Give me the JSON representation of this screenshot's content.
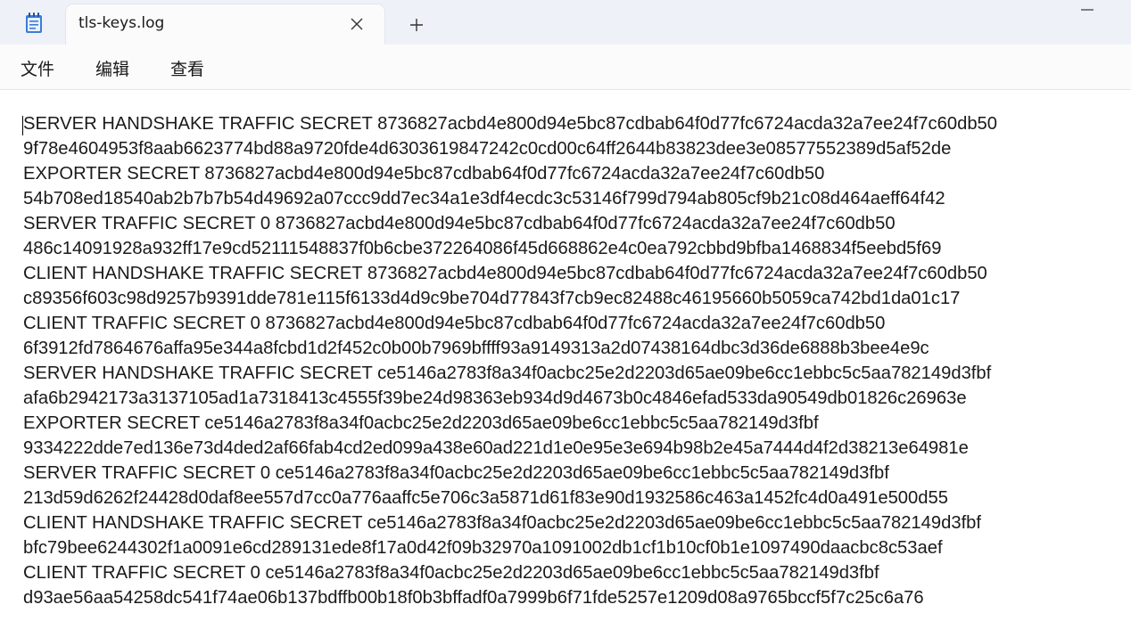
{
  "window": {
    "tab_title": "tls-keys.log",
    "icons": {
      "app": "notepad-icon",
      "close": "close-icon",
      "new_tab": "plus-icon",
      "minimize": "minimize-icon"
    }
  },
  "menu": {
    "items": [
      "文件",
      "编辑",
      "查看"
    ]
  },
  "editor": {
    "lines": [
      "SERVER HANDSHAKE TRAFFIC SECRET 8736827acbd4e800d94e5bc87cdbab64f0d77fc6724acda32a7ee24f7c60db50",
      "9f78e4604953f8aab6623774bd88a9720fde4d6303619847242c0cd00c64ff2644b83823dee3e08577552389d5af52de",
      "EXPORTER SECRET 8736827acbd4e800d94e5bc87cdbab64f0d77fc6724acda32a7ee24f7c60db50",
      "54b708ed18540ab2b7b7b54d49692a07ccc9dd7ec34a1e3df4ecdc3c53146f799d794ab805cf9b21c08d464aeff64f42",
      "SERVER TRAFFIC SECRET 0 8736827acbd4e800d94e5bc87cdbab64f0d77fc6724acda32a7ee24f7c60db50",
      "486c14091928a932ff17e9cd52111548837f0b6cbe372264086f45d668862e4c0ea792cbbd9bfba1468834f5eebd5f69",
      "CLIENT HANDSHAKE TRAFFIC SECRET 8736827acbd4e800d94e5bc87cdbab64f0d77fc6724acda32a7ee24f7c60db50",
      "c89356f603c98d9257b9391dde781e115f6133d4d9c9be704d77843f7cb9ec82488c46195660b5059ca742bd1da01c17",
      "CLIENT TRAFFIC SECRET 0 8736827acbd4e800d94e5bc87cdbab64f0d77fc6724acda32a7ee24f7c60db50",
      "6f3912fd7864676affa95e344a8fcbd1d2f452c0b00b7969bffff93a9149313a2d07438164dbc3d36de6888b3bee4e9c",
      "SERVER HANDSHAKE TRAFFIC SECRET ce5146a2783f8a34f0acbc25e2d2203d65ae09be6cc1ebbc5c5aa782149d3fbf",
      "afa6b2942173a3137105ad1a7318413c4555f39be24d98363eb934d9d4673b0c4846efad533da90549db01826c26963e",
      "EXPORTER SECRET ce5146a2783f8a34f0acbc25e2d2203d65ae09be6cc1ebbc5c5aa782149d3fbf",
      "9334222dde7ed136e73d4ded2af66fab4cd2ed099a438e60ad221d1e0e95e3e694b98b2e45a7444d4f2d38213e64981e",
      "SERVER TRAFFIC SECRET 0 ce5146a2783f8a34f0acbc25e2d2203d65ae09be6cc1ebbc5c5aa782149d3fbf",
      "213d59d6262f24428d0daf8ee557d7cc0a776aaffc5e706c3a5871d61f83e90d1932586c463a1452fc4d0a491e500d55",
      "CLIENT HANDSHAKE TRAFFIC SECRET ce5146a2783f8a34f0acbc25e2d2203d65ae09be6cc1ebbc5c5aa782149d3fbf",
      "bfc79bee6244302f1a0091e6cd289131ede8f17a0d42f09b32970a1091002db1cf1b10cf0b1e1097490daacbc8c53aef",
      "CLIENT TRAFFIC SECRET 0 ce5146a2783f8a34f0acbc25e2d2203d65ae09be6cc1ebbc5c5aa782149d3fbf",
      "d93ae56aa54258dc541f74ae06b137bdffb00b18f0b3bffadf0a7999b6f71fde5257e1209d08a9765bccf5f7c25c6a76"
    ]
  }
}
